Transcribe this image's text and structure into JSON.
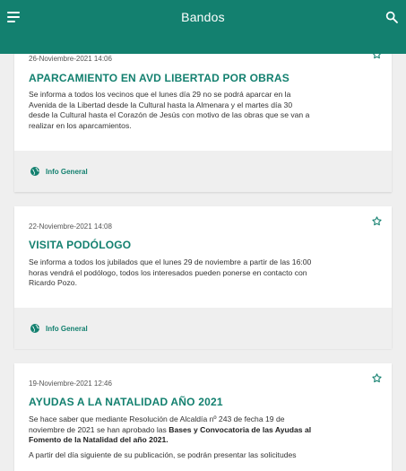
{
  "app": {
    "title": "Bandos",
    "accent": "#13806f"
  },
  "icons": {
    "menu": "menu-icon",
    "search": "search-icon",
    "favorite": "star-outline-icon",
    "category": "globe-icon"
  },
  "posts": [
    {
      "date": "26-Noviembre-2021 14:06",
      "title": "APARCAMIENTO EN AVD LIBERTAD POR OBRAS",
      "body_lines": [
        "Se informa a todos los vecinos que el lunes día 29 no se podrá aparcar en la",
        "Avenida de la Libertad desde la Cultural hasta la Almenara y el martes día 30",
        "desde la Cultural hasta el Corazón de Jesús  con motivo de las obras que se van a",
        "realizar en los aparcamientos."
      ],
      "category": "Info General"
    },
    {
      "date": "22-Noviembre-2021 14:08",
      "title": "VISITA PODÓLOGO",
      "body_lines": [
        "Se informa a todos los jubilados que el lunes 29 de noviembre a partir de las 16:00",
        "horas vendrá el podólogo, todos los interesados pueden ponerse en contacto con",
        "Ricardo Pozo."
      ],
      "category": "Info General"
    },
    {
      "date": "19-Noviembre-2021 12:46",
      "title": "AYUDAS A LA NATALIDAD AÑO 2021",
      "body_line1": "Se hace saber que mediante Resolución de Alcaldía nº 243 de fecha 19 de",
      "body_line2_plain": "noviembre de 2021 se han aprobado las ",
      "body_line2_bold": "Bases y Convocatoria de las Ayudas al",
      "body_line3_bold": "Fomento de la Natalidad del año 2021.",
      "body_line4": "A partir del día siguiente de su publicación, se podrán presentar las solicitudes"
    }
  ]
}
